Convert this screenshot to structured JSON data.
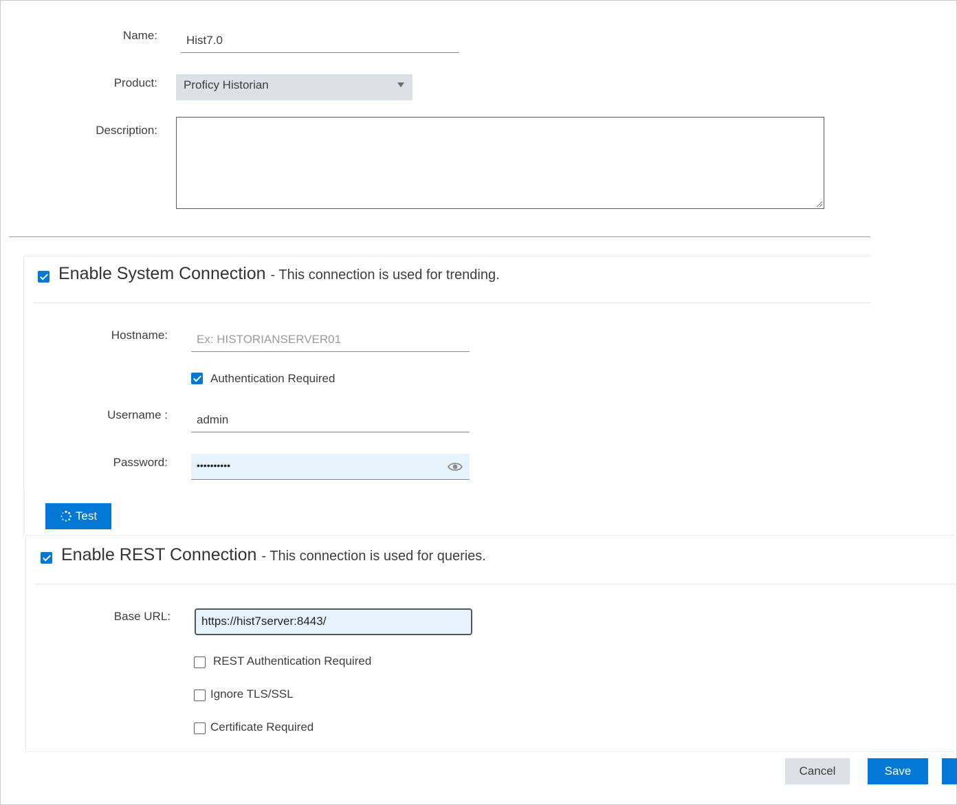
{
  "form": {
    "name_label": "Name:",
    "name_value": "Hist7.0",
    "product_label": "Product:",
    "product_value": "Proficy Historian",
    "description_label": "Description:",
    "description_value": ""
  },
  "system_connection": {
    "enabled": true,
    "title": "Enable System Connection",
    "subtitle": "- This connection is used for trending.",
    "hostname_label": "Hostname:",
    "hostname_placeholder": "Ex: HISTORIANSERVER01",
    "hostname_value": "",
    "auth_required_label": "Authentication Required",
    "auth_required": true,
    "username_label": "Username :",
    "username_value": "admin",
    "password_label": "Password:",
    "password_mask": "••••••••••",
    "test_button_label": "Test"
  },
  "rest_connection": {
    "enabled": true,
    "title": "Enable REST Connection",
    "subtitle": "- This connection is used for queries.",
    "base_url_label": "Base URL:",
    "base_url_value": "https://hist7server:8443/",
    "rest_auth_label": "REST Authentication Required",
    "rest_auth": false,
    "ignore_tls_label": "Ignore TLS/SSL",
    "ignore_tls": false,
    "cert_required_label": "Certificate Required",
    "cert_required": false
  },
  "footer": {
    "cancel_label": "Cancel",
    "save_label": "Save"
  },
  "colors": {
    "accent": "#0078d4",
    "select_bg": "#dde1e6",
    "focused_input_bg": "#e6f3fd"
  }
}
